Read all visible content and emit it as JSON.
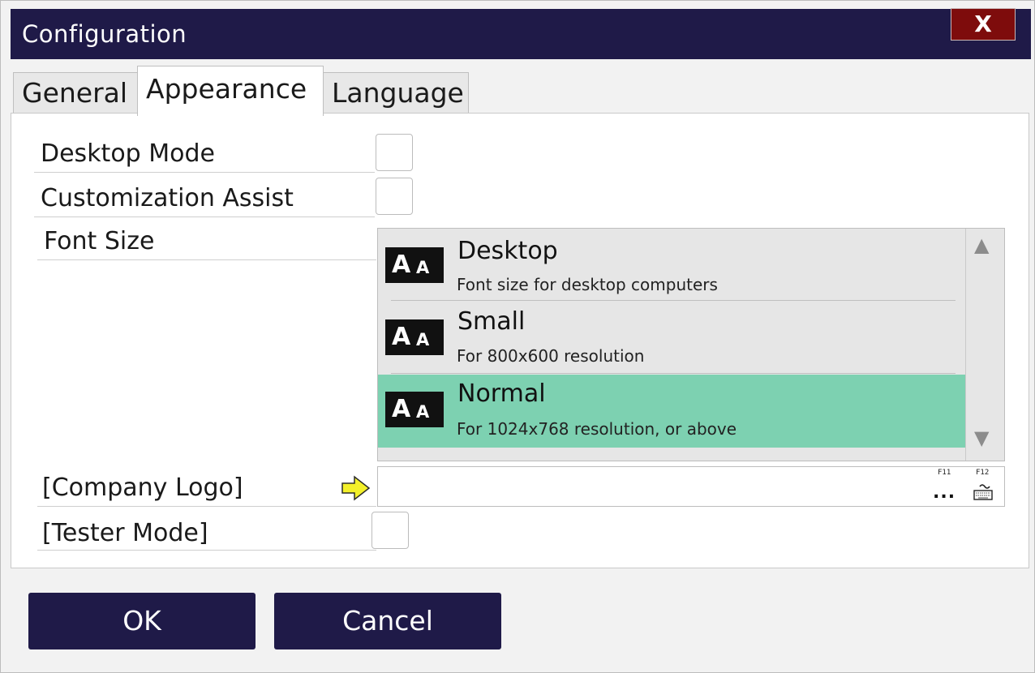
{
  "window": {
    "title": "Configuration",
    "close_label": "X"
  },
  "tabs": [
    {
      "label": "General",
      "active": false
    },
    {
      "label": "Appearance",
      "active": true
    },
    {
      "label": "Language",
      "active": false
    }
  ],
  "settings": {
    "desktop_mode": {
      "label": "Desktop Mode",
      "checked": false
    },
    "customization_assist": {
      "label": "Customization Assist",
      "checked": false
    },
    "font_size": {
      "label": "Font Size",
      "options": [
        {
          "icon_big": "A",
          "icon_small": "A",
          "title": "Desktop",
          "description": "Font size for desktop computers",
          "selected": false
        },
        {
          "icon_big": "A",
          "icon_small": "A",
          "title": "Small",
          "description": "For 800x600 resolution",
          "selected": false
        },
        {
          "icon_big": "A",
          "icon_small": "A",
          "title": "Normal",
          "description": "For 1024x768 resolution, or above",
          "selected": true
        }
      ],
      "scroll_up": "▲",
      "scroll_down": "▼"
    },
    "company_logo": {
      "label": "[Company Logo]",
      "value": "",
      "f11": "F11",
      "f12": "F12",
      "browse_glyph": "...",
      "arrow_icon": "arrow-right-icon",
      "keyboard_icon": "keyboard-icon"
    },
    "tester_mode": {
      "label": "[Tester Mode]",
      "checked": false
    }
  },
  "buttons": {
    "ok": "OK",
    "cancel": "Cancel"
  },
  "colors": {
    "titlebar": "#1f1a48",
    "close": "#7e0c0c",
    "selected_row": "#7dd1b1",
    "arrow": "#f3f02a"
  }
}
